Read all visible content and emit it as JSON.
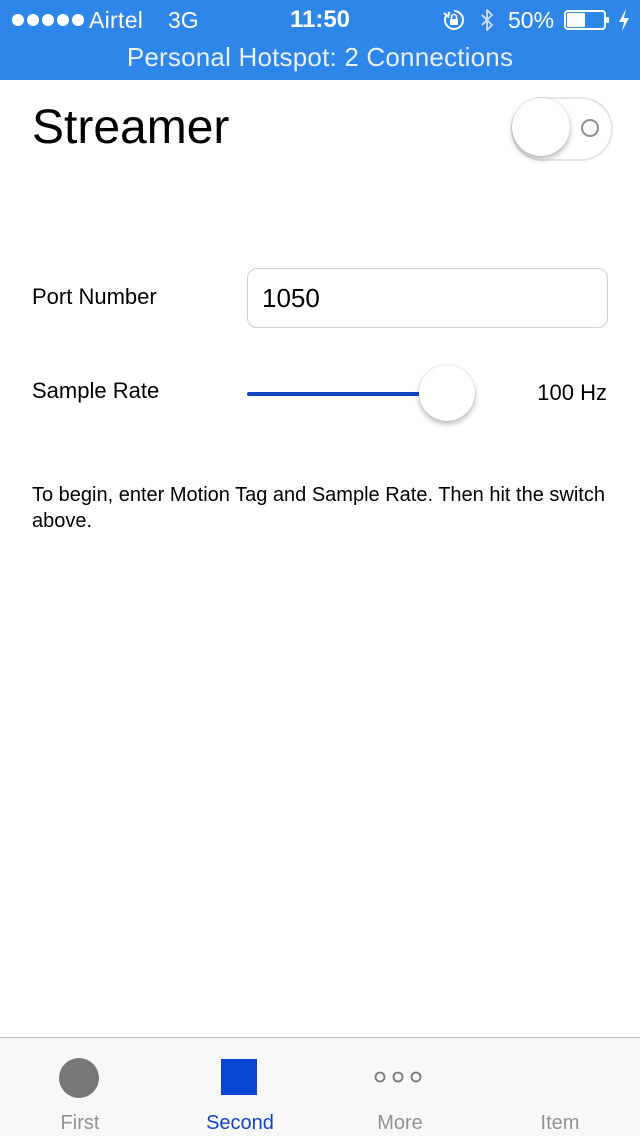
{
  "status_bar": {
    "carrier": "Airtel",
    "network": "3G",
    "time": "11:50",
    "battery_percent": "50%",
    "battery_level": 0.5,
    "icons": [
      "signal-dots-icon",
      "rotation-lock-icon",
      "bluetooth-icon",
      "battery-icon",
      "charging-icon"
    ],
    "background_color": "#2f86e9"
  },
  "hotspot_banner": "Personal Hotspot: 2 Connections",
  "header": {
    "title": "Streamer",
    "streaming_switch_on": false
  },
  "form": {
    "port_label": "Port Number",
    "port_value": "1050",
    "rate_label": "Sample Rate",
    "rate_value_text": "100 Hz",
    "rate_slider_fraction": 1.0
  },
  "instructions": "To begin, enter Motion Tag and Sample Rate. Then hit the switch above.",
  "tab_bar": {
    "accent_color": "#0f46bf",
    "selected_tab": "Second",
    "tabs": [
      {
        "label": "First",
        "icon": "circle-icon"
      },
      {
        "label": "Second",
        "icon": "square-icon"
      },
      {
        "label": "More",
        "icon": "more-icon"
      },
      {
        "label": "Item",
        "icon": ""
      }
    ]
  }
}
